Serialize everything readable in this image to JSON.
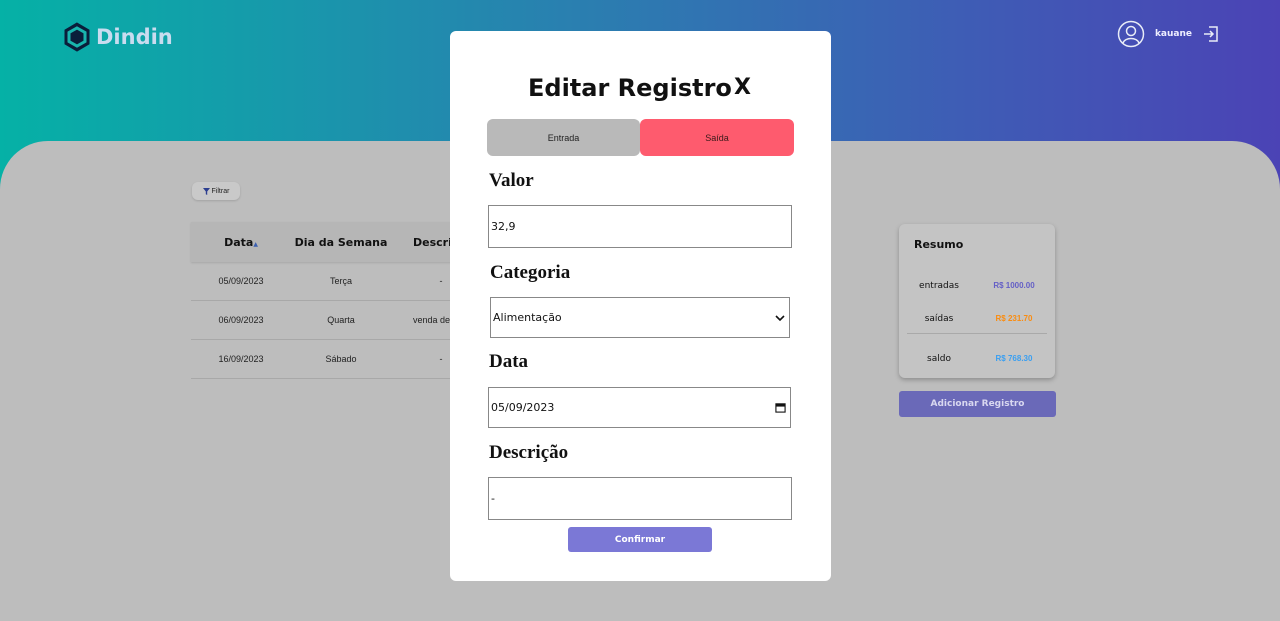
{
  "app": {
    "name": "Dindin"
  },
  "user": {
    "name": "kauane"
  },
  "filter": {
    "label": "Filtrar"
  },
  "table": {
    "headers": [
      "Data",
      "Dia da Semana",
      "Descri"
    ],
    "rows": [
      [
        "05/09/2023",
        "Terça",
        "-"
      ],
      [
        "06/09/2023",
        "Quarta",
        "venda de"
      ],
      [
        "16/09/2023",
        "Sábado",
        "-"
      ]
    ]
  },
  "resumo": {
    "title": "Resumo",
    "entradas_label": "entradas",
    "entradas_value": "R$ 1000.00",
    "saidas_label": "saídas",
    "saidas_value": "R$ 231.70",
    "saldo_label": "saldo",
    "saldo_value": "R$ 768.30"
  },
  "add_button": "Adicionar Registro",
  "modal": {
    "title": "Editar Registro",
    "close": "X",
    "tab_entrada": "Entrada",
    "tab_saida": "Saída",
    "valor_label": "Valor",
    "valor_value": "32,9",
    "categoria_label": "Categoria",
    "categoria_value": "Alimentação",
    "data_label": "Data",
    "data_value": "05/09/2023",
    "descricao_label": "Descrição",
    "descricao_value": "-",
    "confirm": "Confirmar"
  },
  "colors": {
    "accent": "#7b78d6",
    "saida_tab": "#fe5b6e",
    "entradas_value": "#645fc6",
    "saidas_value": "#fa8c10",
    "saldo_value": "#3a9ff1"
  }
}
